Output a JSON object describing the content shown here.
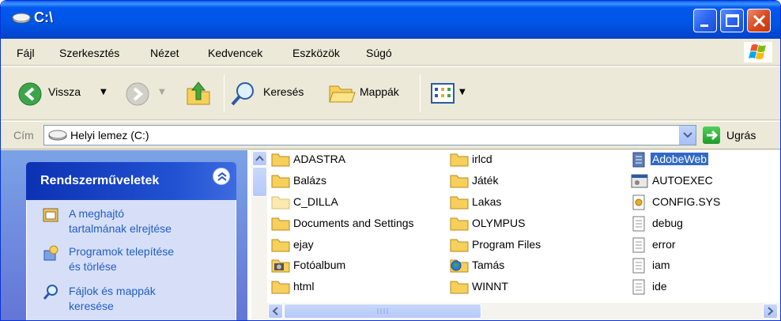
{
  "window": {
    "title": "C:\\"
  },
  "menu": [
    "Fájl",
    "Szerkesztés",
    "Nézet",
    "Kedvencek",
    "Eszközök",
    "Súgó"
  ],
  "toolbar": {
    "back_label": "Vissza",
    "search_label": "Keresés",
    "folders_label": "Mappák"
  },
  "address": {
    "label": "Cím",
    "value": "Helyi lemez (C:)",
    "go_label": "Ugrás"
  },
  "tasks": {
    "title": "Rendszerműveletek",
    "items": [
      {
        "line1": "A meghajtó",
        "line2": "tartalmának elrejtése",
        "icon": "hide-drive-icon"
      },
      {
        "line1": "Programok telepítése",
        "line2": "és törlése",
        "icon": "add-remove-programs-icon"
      },
      {
        "line1": "Fájlok és mappák",
        "line2": "keresése",
        "icon": "search-icon"
      }
    ]
  },
  "files": {
    "col1": [
      "ADASTRA",
      "Balázs",
      "C_DILLA",
      "Documents and Settings",
      "ejay",
      "Fotóalbum",
      "html"
    ],
    "col2": [
      "irlcd",
      "Játék",
      "Lakas",
      "OLYMPUS",
      "Program Files",
      "Tamás",
      "WINNT"
    ],
    "col3": [
      "AdobeWeb",
      "AUTOEXEC",
      "CONFIG.SYS",
      "debug",
      "error",
      "iam",
      "ide"
    ],
    "selected": "AdobeWeb"
  },
  "colors": {
    "titlebar": "#0055e5",
    "selection": "#316ac5",
    "link": "#215dc6"
  }
}
